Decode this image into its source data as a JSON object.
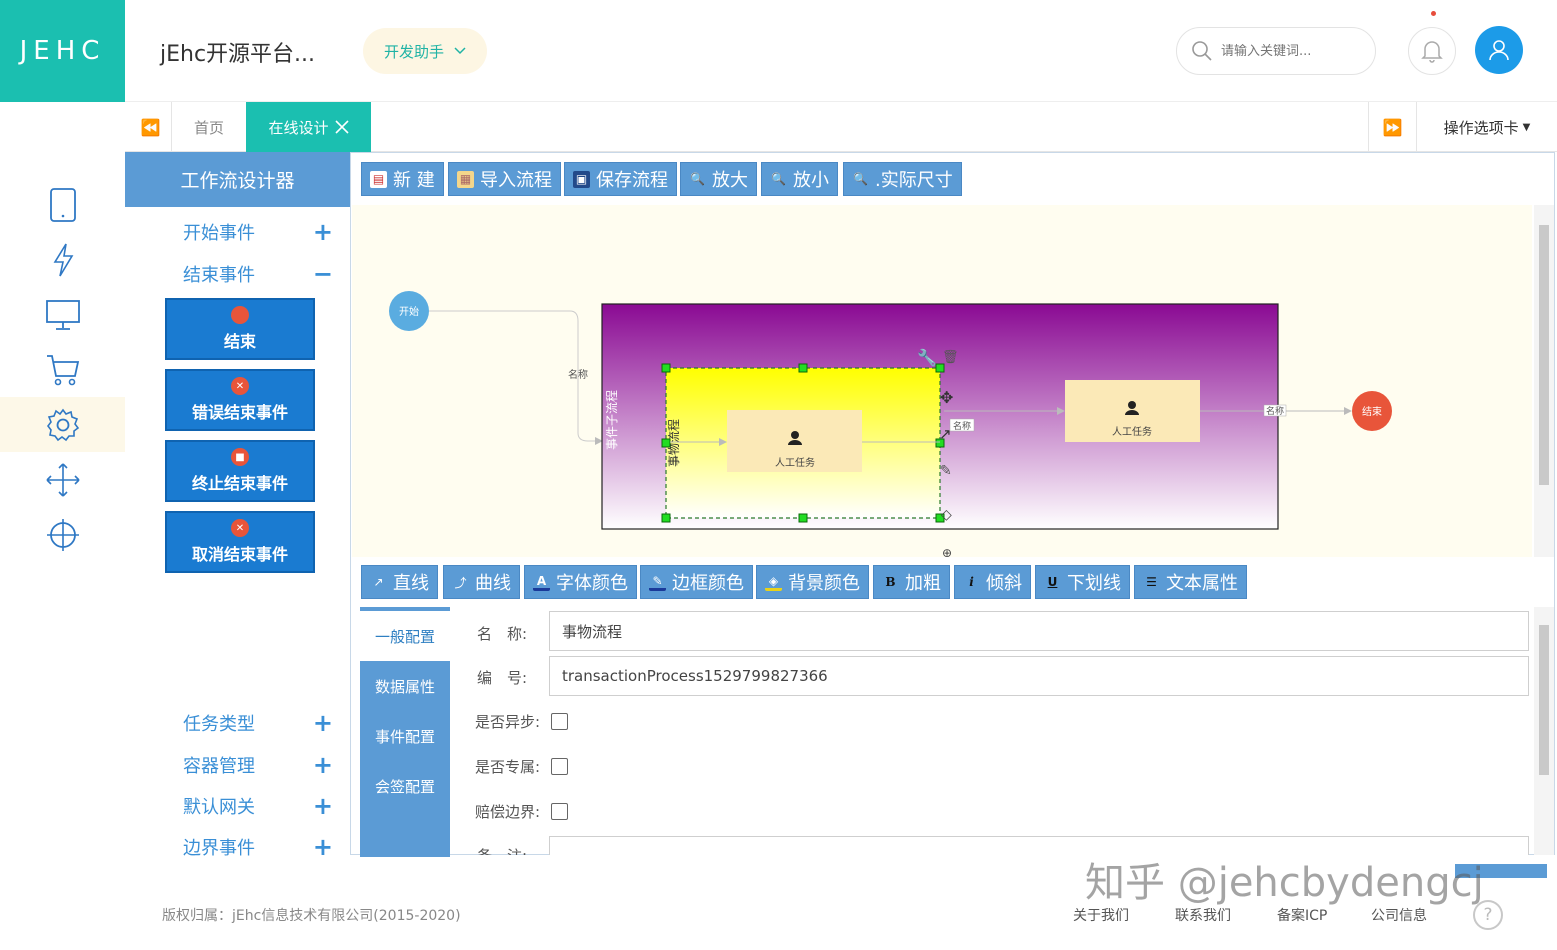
{
  "header": {
    "logo": "JEHC",
    "app_title": "jEhc开源平台...",
    "dev_helper": "开发助手",
    "search_placeholder": "请输入关键词...",
    "icons": [
      "search-icon",
      "bell-icon",
      "user-icon"
    ]
  },
  "rail": {
    "items": [
      "tablet-icon",
      "lightning-icon",
      "monitor-icon",
      "cart-icon",
      "gear-icon",
      "move-icon",
      "crosshair-icon"
    ],
    "active_index": 4
  },
  "tabs": {
    "home": "首页",
    "current": "在线设计",
    "ops": "操作选项卡"
  },
  "designer": {
    "title": "工作流设计器",
    "categories": {
      "start_event": "开始事件",
      "end_event": "结束事件",
      "task_type": "任务类型",
      "container": "容器管理",
      "gateway": "默认网关",
      "boundary": "边界事件"
    },
    "end_events": [
      "结束",
      "错误结束事件",
      "终止结束事件",
      "取消结束事件"
    ],
    "toolbar_top": [
      "新 建",
      "导入流程",
      "保存流程",
      "放大",
      "放小",
      ".实际尺寸"
    ],
    "toolbar_bottom": [
      "直线",
      "曲线",
      "字体颜色",
      "边框颜色",
      "背景颜色",
      "加粗",
      "倾斜",
      "下划线",
      "文本属性"
    ],
    "diagram": {
      "start_label": "开始",
      "end_label": "结束",
      "subprocess_label": "事件子流程",
      "transaction_label": "事物流程",
      "task1_label": "人工任务",
      "task2_label": "人工任务",
      "edge_label_1": "名称",
      "edge_label_2": "名称",
      "edge_label_3": "名称"
    },
    "prop_tabs": [
      "一般配置",
      "数据属性",
      "事件配置",
      "会签配置"
    ],
    "props": {
      "name_label": "名　称:",
      "name_value": "事物流程",
      "id_label": "编　号:",
      "id_value": "transactionProcess1529799827366",
      "async_label": "是否异步:",
      "exclusive_label": "是否专属:",
      "compensation_label": "赔偿边界:",
      "note_label": "备　注:"
    }
  },
  "footer": {
    "copyright": "版权归属：jEhc信息技术有限公司(2015-2020)",
    "links": [
      "关于我们",
      "联系我们",
      "备案ICP",
      "公司信息"
    ],
    "help": "?"
  },
  "watermark": "知乎 @jehcbydengcj",
  "colors": {
    "brand_teal": "#1bbfb0",
    "toolbar_blue": "#5b9bd5",
    "palette_blue": "#1a7bd1",
    "start_node": "#5aace0",
    "end_node": "#e8553a"
  }
}
